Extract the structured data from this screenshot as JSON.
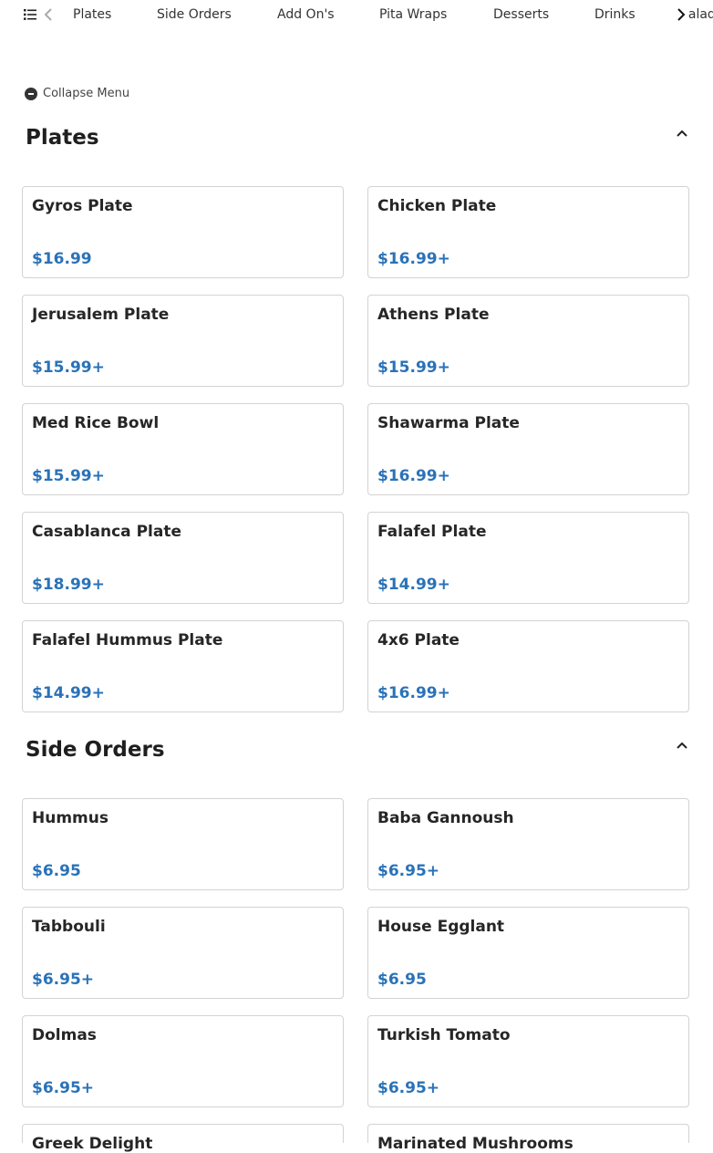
{
  "nav": {
    "items": [
      "Plates",
      "Side Orders",
      "Add On's",
      "Pita Wraps",
      "Desserts",
      "Drinks",
      "Salad"
    ]
  },
  "collapse_label": "Collapse Menu",
  "sections": [
    {
      "title": "Plates",
      "items": [
        {
          "name": "Gyros Plate",
          "price": "$16.99"
        },
        {
          "name": "Chicken Plate",
          "price": "$16.99+"
        },
        {
          "name": "Jerusalem Plate",
          "price": "$15.99+"
        },
        {
          "name": "Athens Plate",
          "price": "$15.99+"
        },
        {
          "name": "Med Rice Bowl",
          "price": "$15.99+"
        },
        {
          "name": "Shawarma Plate",
          "price": "$16.99+"
        },
        {
          "name": "Casablanca Plate",
          "price": "$18.99+"
        },
        {
          "name": "Falafel Plate",
          "price": "$14.99+"
        },
        {
          "name": "Falafel Hummus Plate",
          "price": "$14.99+"
        },
        {
          "name": "4x6 Plate",
          "price": "$16.99+"
        }
      ]
    },
    {
      "title": "Side Orders",
      "items": [
        {
          "name": "Hummus",
          "price": "$6.95"
        },
        {
          "name": "Baba Gannoush",
          "price": "$6.95+"
        },
        {
          "name": "Tabbouli",
          "price": "$6.95+"
        },
        {
          "name": "House Egglant",
          "price": "$6.95"
        },
        {
          "name": "Dolmas",
          "price": "$6.95+"
        },
        {
          "name": "Turkish Tomato",
          "price": "$6.95+"
        },
        {
          "name": "Greek Delight",
          "price": ""
        },
        {
          "name": "Marinated Mushrooms",
          "price": ""
        }
      ]
    }
  ],
  "colors": {
    "price": "#2a72b8",
    "card_border": "#d3d3d3",
    "text": "#222222"
  },
  "icons": [
    "list-icon",
    "chevron-left-icon",
    "chevron-right-icon",
    "minus-circle-icon",
    "chevron-up-icon"
  ]
}
